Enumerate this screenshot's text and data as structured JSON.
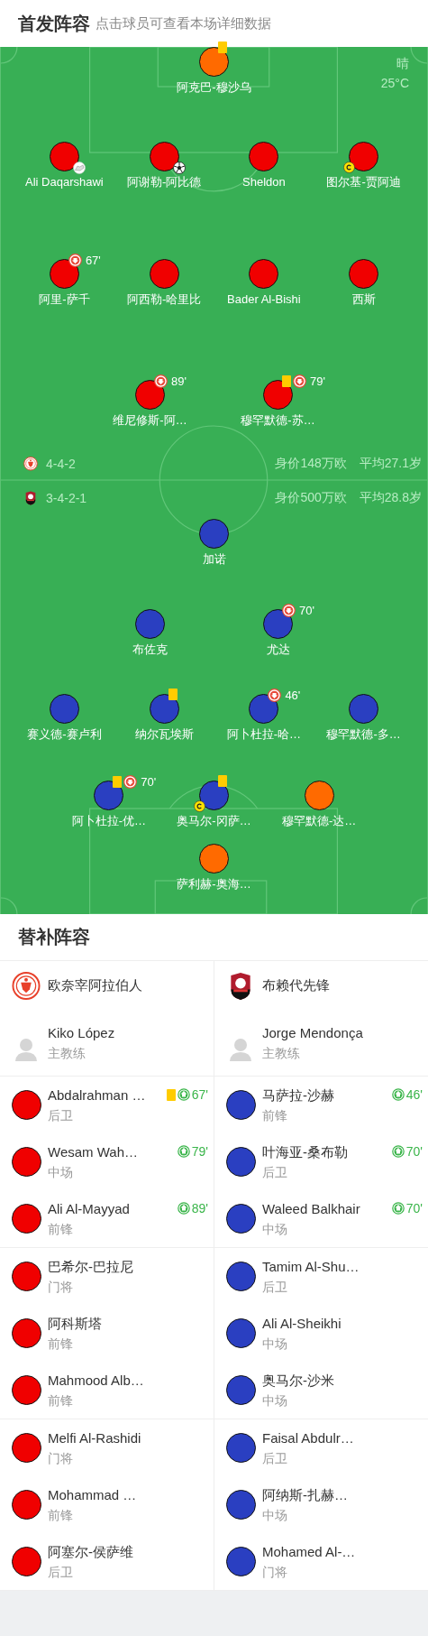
{
  "header": {
    "title": "首发阵容",
    "subtitle": "点击球员可查看本场详细数据"
  },
  "pitch": {
    "weather": {
      "condition": "晴",
      "temperature": "25°C"
    },
    "home": {
      "lines": [
        [
          {
            "name": "阿克巴-穆沙乌",
            "color": "#ff6a00",
            "events": [
              {
                "kind": "yellow"
              }
            ]
          }
        ],
        [
          {
            "name": "Ali Daqarshawi",
            "color": "#f00000",
            "events": [
              {
                "kind": "assist"
              }
            ]
          },
          {
            "name": "阿谢勒-阿比德",
            "color": "#f00000",
            "events": [
              {
                "kind": "goal"
              }
            ]
          },
          {
            "name": "Sheldon",
            "color": "#f00000"
          },
          {
            "name": "图尔基-贾阿迪",
            "color": "#f00000",
            "events": [
              {
                "kind": "captain"
              }
            ]
          }
        ],
        [
          {
            "name": "阿里-萨千",
            "color": "#f00000",
            "events": [
              {
                "kind": "sub_out",
                "minute": "67'"
              }
            ]
          },
          {
            "name": "阿西勒-哈里比",
            "color": "#f00000"
          },
          {
            "name": "Bader Al-Bishi",
            "color": "#f00000"
          },
          {
            "name": "西斯",
            "color": "#f00000"
          }
        ],
        [
          {
            "name": "维尼修斯-阿…",
            "color": "#f00000",
            "events": [
              {
                "kind": "sub_out",
                "minute": "89'"
              }
            ]
          },
          {
            "name": "穆罕默德-苏…",
            "color": "#f00000",
            "events": [
              {
                "kind": "yellow"
              },
              {
                "kind": "sub_out",
                "minute": "79'"
              }
            ]
          }
        ]
      ]
    },
    "info": [
      {
        "kind": "home",
        "formation": "4-4-2",
        "value": "身价148万欧",
        "age": "平均27.1岁"
      },
      {
        "kind": "away",
        "formation": "3-4-2-1",
        "value": "身价500万欧",
        "age": "平均28.8岁"
      }
    ],
    "away": {
      "lines": [
        [
          {
            "name": "加诺",
            "color": "#2a3fc1"
          }
        ],
        [
          {
            "name": "布佐克",
            "color": "#2a3fc1"
          },
          {
            "name": "尤达",
            "color": "#2a3fc1",
            "events": [
              {
                "kind": "sub_out",
                "minute": "70'"
              }
            ]
          }
        ],
        [
          {
            "name": "赛义德-赛卢利",
            "color": "#2a3fc1"
          },
          {
            "name": "纳尔瓦埃斯",
            "color": "#2a3fc1",
            "events": [
              {
                "kind": "yellow"
              }
            ]
          },
          {
            "name": "阿卜杜拉-哈…",
            "color": "#2a3fc1",
            "events": [
              {
                "kind": "sub_out",
                "minute": "46'"
              }
            ]
          },
          {
            "name": "穆罕默德-多…",
            "color": "#2a3fc1"
          }
        ],
        [
          {
            "name": "阿卜杜拉-优…",
            "color": "#2a3fc1",
            "events": [
              {
                "kind": "yellow"
              },
              {
                "kind": "sub_out",
                "minute": "70'"
              }
            ]
          },
          {
            "name": "奥马尔-冈萨…",
            "color": "#2a3fc1",
            "events": [
              {
                "kind": "yellow"
              },
              {
                "kind": "captain"
              }
            ]
          },
          {
            "name": "穆罕默德-达…",
            "color": "#ff6a00"
          }
        ],
        [
          {
            "name": "萨利赫-奥海…",
            "color": "#ff6a00"
          }
        ]
      ]
    }
  },
  "subs": {
    "title": "替补阵容",
    "teams": [
      {
        "kind": "home",
        "name": "欧奈宰阿拉伯人",
        "coach": {
          "name": "Kiko López",
          "role": "主教练"
        },
        "groups": [
          [
            {
              "name": "Abdalrahman …",
              "position": "后卫",
              "color": "#f00000",
              "events": [
                {
                  "kind": "yellow"
                },
                {
                  "kind": "sub_in",
                  "minute": "67'"
                }
              ]
            },
            {
              "name": "Wesam Wah…",
              "position": "中场",
              "color": "#f00000",
              "events": [
                {
                  "kind": "sub_in",
                  "minute": "79'"
                }
              ]
            },
            {
              "name": "Ali Al-Mayyad",
              "position": "前锋",
              "color": "#f00000",
              "events": [
                {
                  "kind": "sub_in",
                  "minute": "89'"
                }
              ]
            }
          ],
          [
            {
              "name": "巴希尔-巴拉尼",
              "position": "门将",
              "color": "#f00000"
            },
            {
              "name": "阿科斯塔",
              "position": "前锋",
              "color": "#f00000"
            },
            {
              "name": "Mahmood Alb…",
              "position": "前锋",
              "color": "#f00000"
            }
          ],
          [
            {
              "name": "Melfi Al-Rashidi",
              "position": "门将",
              "color": "#f00000"
            },
            {
              "name": "Mohammad …",
              "position": "前锋",
              "color": "#f00000"
            },
            {
              "name": "阿塞尔-侯萨维",
              "position": "后卫",
              "color": "#f00000"
            }
          ]
        ]
      },
      {
        "kind": "away",
        "name": "布赖代先锋",
        "coach": {
          "name": "Jorge Mendonça",
          "role": "主教练"
        },
        "groups": [
          [
            {
              "name": "马萨拉-沙赫",
              "position": "前锋",
              "color": "#2a3fc1",
              "events": [
                {
                  "kind": "sub_in",
                  "minute": "46'"
                }
              ]
            },
            {
              "name": "叶海亚-桑布勒",
              "position": "后卫",
              "color": "#2a3fc1",
              "events": [
                {
                  "kind": "sub_in",
                  "minute": "70'"
                }
              ]
            },
            {
              "name": "Waleed Balkhair",
              "position": "中场",
              "color": "#2a3fc1",
              "events": [
                {
                  "kind": "sub_in",
                  "minute": "70'"
                }
              ]
            }
          ],
          [
            {
              "name": "Tamim Al-Shu…",
              "position": "后卫",
              "color": "#2a3fc1"
            },
            {
              "name": "Ali Al-Sheikhi",
              "position": "中场",
              "color": "#2a3fc1"
            },
            {
              "name": "奥马尔-沙米",
              "position": "中场",
              "color": "#2a3fc1"
            }
          ],
          [
            {
              "name": "Faisal Abdulr…",
              "position": "后卫",
              "color": "#2a3fc1"
            },
            {
              "name": "阿纳斯-扎赫…",
              "position": "中场",
              "color": "#2a3fc1"
            },
            {
              "name": "Mohamed Al-…",
              "position": "门将",
              "color": "#2a3fc1"
            }
          ]
        ]
      }
    ]
  }
}
